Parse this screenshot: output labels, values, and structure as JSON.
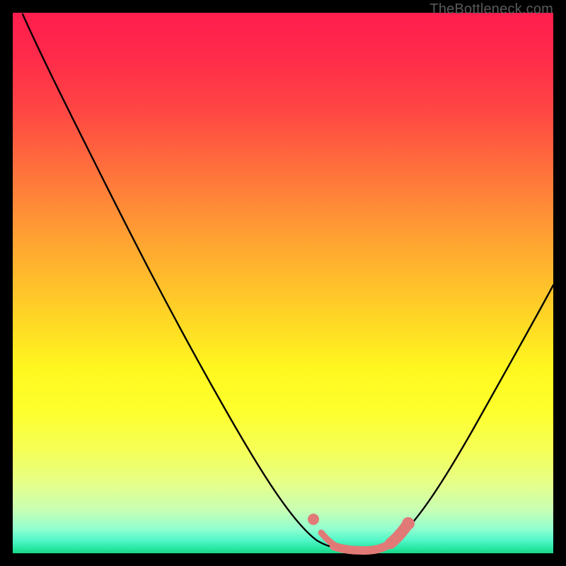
{
  "watermark": "TheBottleneck.com",
  "chart_data": {
    "type": "line",
    "title": "",
    "xlabel": "",
    "ylabel": "",
    "xlim": [
      0,
      100
    ],
    "ylim": [
      0,
      100
    ],
    "series": [
      {
        "name": "bottleneck-curve",
        "x": [
          2,
          8,
          16,
          24,
          32,
          40,
          48,
          54,
          58,
          60,
          62,
          64,
          66,
          68,
          71,
          75,
          80,
          86,
          92,
          98,
          100
        ],
        "y": [
          100,
          89,
          76,
          63,
          50,
          37,
          24,
          14,
          7,
          4,
          2.5,
          2,
          2,
          2.2,
          3,
          6,
          12,
          22,
          34,
          48,
          53
        ]
      }
    ],
    "highlight": {
      "name": "optimal-flat-region",
      "x_range": [
        56,
        72
      ],
      "description": "pink band near curve minimum"
    },
    "colors": {
      "gradient_top": "#ff1e4e",
      "gradient_mid": "#fff81f",
      "gradient_bottom": "#18d884",
      "curve": "#000000",
      "highlight": "#e17a77",
      "frame": "#000000"
    }
  }
}
